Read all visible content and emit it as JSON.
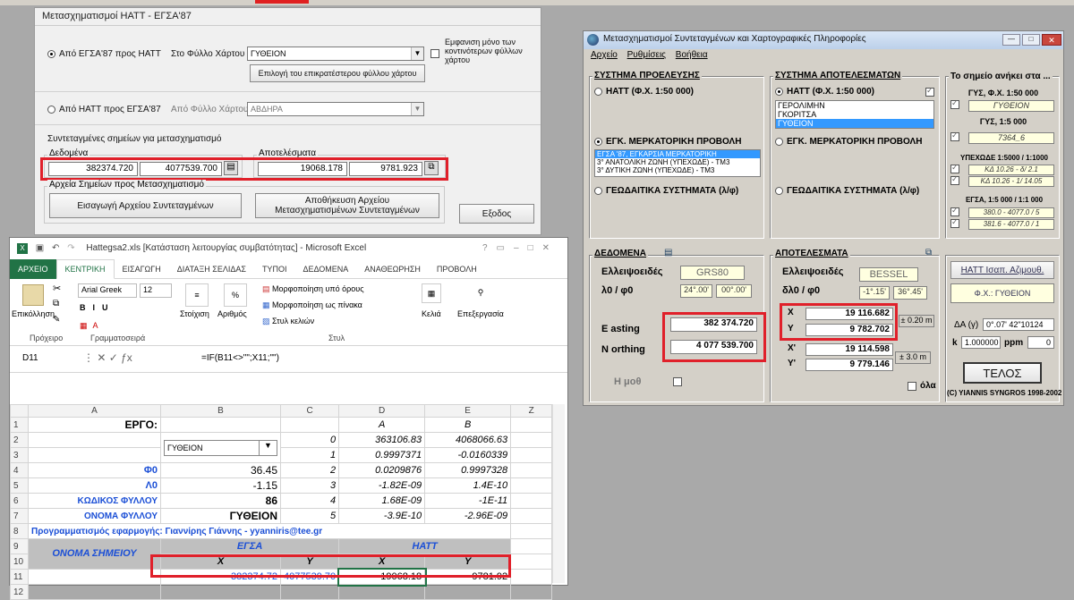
{
  "dialog1": {
    "title": "Μετασχηματισμοί ΗΑΤΤ - ΕΓΣΑ'87",
    "radio_egsa_to_hatt": "Από ΕΓΣΑ'87 προς ΗΑΤΤ",
    "sheet_label1": "Στο Φύλλο Χάρτου",
    "sheet_value1": "ΓΥΘΕΙΟΝ",
    "check_label": "Εμφανιση μόνο των κοντινότερων φύλλων χάρτου",
    "select_sheet_button": "Επιλογή του επικρατέστερου φύλλου χάρτου",
    "radio_hatt_to_egsa": "Από ΗΑΤΤ προς ΕΓΣΑ'87",
    "sheet_label2": "Από Φύλλο Χάρτου",
    "sheet_value2": "ΑΒΔΗΡΑ",
    "coords_heading": "Συντεταγμένες σημείων για μετασχηματισμό",
    "data_group": "Δεδομένα",
    "data_x": "382374.720",
    "data_y": "4077539.700",
    "results_group": "Αποτελέσματα",
    "result_x": "19068.178",
    "result_y": "9781.923",
    "files_group": "Αρχεία Σημείων προς Μετασχηματισμό",
    "import_button": "Εισαγωγή Αρχείου Συντεταγμένων",
    "save_button": "Αποθήκευση Αρχείου Μετασχηματισμένων Συντεταγμένων",
    "exit_button": "Εξοδος"
  },
  "dialog2": {
    "title": "Μετασχηματισμοί Συντεταγμένων και Χαρτογραφικές Πληροφορίες",
    "menu": [
      "Αρχείο",
      "Ρυθμίσεις",
      "Βοήθεια"
    ],
    "source_title": "ΣΥΣΤΗΜΑ ΠΡΟΕΛΕΥΣΗΣ",
    "source_opt1": "ΗΑΤΤ (Φ.Χ. 1:50 000)",
    "source_opt2": "ΕΓΚ. ΜΕΡΚΑΤΟΡΙΚΗ ΠΡΟΒΟΛΗ",
    "source_list": [
      "ΕΓΣΑ '87, ΕΓΚΑΡΣΙΑ ΜΕΡΚΑΤΟΡΙΚΗ",
      "3° ΑΝΑΤΟΛΙΚΗ ΖΩΝΗ (ΥΠΕΧΩΔΕ) - ΤΜ3",
      "3° ΔΥΤΙΚΗ ΖΩΝΗ (ΥΠΕΧΩΔΕ) - ΤΜ3"
    ],
    "source_opt3": "ΓΕΩΔΑΙΤΙΚΑ ΣΥΣΤΗΜΑΤΑ (λ/φ)",
    "result_title": "ΣΥΣΤΗΜΑ ΑΠΟΤΕΛΕΣΜΑΤΩΝ",
    "result_opt1": "ΗΑΤΤ (Φ.Χ. 1:50 000)",
    "result_list": [
      "ΓΕΡΟΛΙΜΗΝ",
      "ΓΚΟΡΙΤΣΑ",
      "ΓΥΘΕΙΟΝ"
    ],
    "result_opt2": "ΕΓΚ. ΜΕΡΚΑΤΟΡΙΚΗ ΠΡΟΒΟΛΗ",
    "result_opt3": "ΓΕΩΔΑΙΤΙΚΑ ΣΥΣΤΗΜΑΤΑ (λ/φ)",
    "belongs_title": "Το σημείο ανήκει στα ...",
    "gys50_label": "ΓΥΣ, Φ.Χ. 1:50 000",
    "gys50_value": "ΓΥΘΕΙΟΝ",
    "gys5_label": "ΓΥΣ, 1:5 000",
    "gys5_value": "7364_6",
    "ypexode_label": "ΥΠΕΧΩΔΕ 1:5000 / 1:1000",
    "ypexode_values": [
      "ΚΔ 10.26 - δ/ 2.1",
      "ΚΔ 10.26 - 1/ 14.05"
    ],
    "egsa_label": "ΕΓΣΑ, 1:5 000 / 1:1 000",
    "egsa_values": [
      "380.0 - 4077.0 / 5",
      "381.6 - 4077.0 / 1"
    ],
    "data_title": "ΔΕΔΟΜΕΝΑ",
    "ellipsoid_label": "Ελλειψοειδές",
    "ellipsoid_value": "GRS80",
    "lambda_label": "λ0 / φ0",
    "lambda_value": "24°.00'",
    "phi_value": "00°.00'",
    "easting_label": "E asting",
    "easting_value": "382 374.720",
    "northing_label": "N orthing",
    "northing_value": "4 077 539.700",
    "h_label": "Η μοθ",
    "results_title": "ΑΠΟΤΕΛΕΣΜΑΤΑ",
    "res_ellipsoid_value": "BESSEL",
    "dlambda_label": "δλ0 / φ0",
    "dlambda_value": "-1°.15'",
    "dphi_value": "36°.45'",
    "x_label": "X",
    "x_value": "19 116.682",
    "y_label": "Y",
    "y_value": "9 782.702",
    "xprime_label": "X'",
    "xprime_value": "19 114.598",
    "yprime_label": "Y'",
    "yprime_value": "9 779.146",
    "acc1": "± 0.20 m",
    "acc2": "± 3.0 m",
    "all_label": "όλα",
    "hatt_button": "ΗΑΤΤ Ισαπ. Αζιμουθ.",
    "fx_value": "Φ.Χ.: ΓΥΘΕΙΟΝ",
    "da_label": "ΔΑ (γ)",
    "da_value": "0°.07' 42\"10124",
    "k_label": "k",
    "k_value": "1.000000",
    "ppm_label": "ppm",
    "ppm_value": "0",
    "end_button": "ΤΕΛΟΣ",
    "copyright": "(C) YIANNIS SYNGROS 1998-2002"
  },
  "excel": {
    "title": "Hattegsa2.xls [Κατάσταση λειτουργίας συμβατότητας] - Microsoft Excel",
    "tabs": [
      "ΑΡΧΕΙΟ",
      "ΚΕΝΤΡΙΚΗ",
      "ΕΙΣΑΓΩΓΗ",
      "ΔΙΑΤΑΞΗ ΣΕΛΙΔΑΣ",
      "ΤΥΠΟΙ",
      "ΔΕΔΟΜΕΝΑ",
      "ΑΝΑΘΕΩΡΗΣΗ",
      "ΠΡΟΒΟΛΗ"
    ],
    "ribbon": {
      "paste": "Επικόλληση",
      "font": "Arial Greek",
      "size": "12",
      "styles1": "Μορφοποίηση υπό όρους",
      "styles2": "Μορφοποίηση ως πίνακα",
      "styles3": "Στυλ κελιών",
      "align": "Στοίχιση",
      "number": "Αριθμός",
      "cells": "Κελιά",
      "edit": "Επεξεργασία",
      "g_clip": "Πρόχειρο",
      "g_font": "Γραμματοσειρά",
      "g_style": "Στυλ"
    },
    "cell_ref": "D11",
    "formula": "=IF(B11<>\"\";X11;\"\")",
    "cols": [
      "A",
      "B",
      "C",
      "D",
      "E",
      "Z"
    ],
    "r1": {
      "a": "ΕΡΓΟ:",
      "d": "A",
      "e": "B"
    },
    "combo": "ΓΥΘΕΙΟΝ",
    "coef": [
      {
        "n": "0",
        "d": "363106.83",
        "e": "4068066.63"
      },
      {
        "n": "1",
        "d": "0.9997371",
        "e": "-0.0160339"
      },
      {
        "n": "2",
        "d": "0.0209876",
        "e": "0.9997328"
      },
      {
        "n": "3",
        "d": "-1.82E-09",
        "e": "1.4E-10"
      },
      {
        "n": "4",
        "d": "1.68E-09",
        "e": "-1E-11"
      },
      {
        "n": "5",
        "d": "-3.9E-10",
        "e": "-2.96E-09"
      }
    ],
    "phi_label": "Φ0",
    "phi_val": "36.45",
    "lam_label": "Λ0",
    "lam_val": "-1.15",
    "code_label": "ΚΩΔΙΚΟΣ ΦΥΛΛΟΥ",
    "code_val": "86",
    "name_label": "ΟΝΟΜΑ ΦΥΛΛΟΥ",
    "name_val": "ΓΥΘΕΙΟΝ",
    "program": "Προγραμματισμός εφαρμογής: Γιαννίρης Γιάννης - yyanniris@tee.gr",
    "h_point": "ΟΝΟΜΑ ΣΗΜΕΙΟΥ",
    "h_egsa": "ΕΓΣΑ",
    "h_hatt": "ΗΑΤΤ",
    "hx": "X",
    "hy": "Y",
    "r11": {
      "b": "382374.72",
      "c": "4077539.70",
      "d": "19068.18",
      "e": "9781.92"
    }
  }
}
